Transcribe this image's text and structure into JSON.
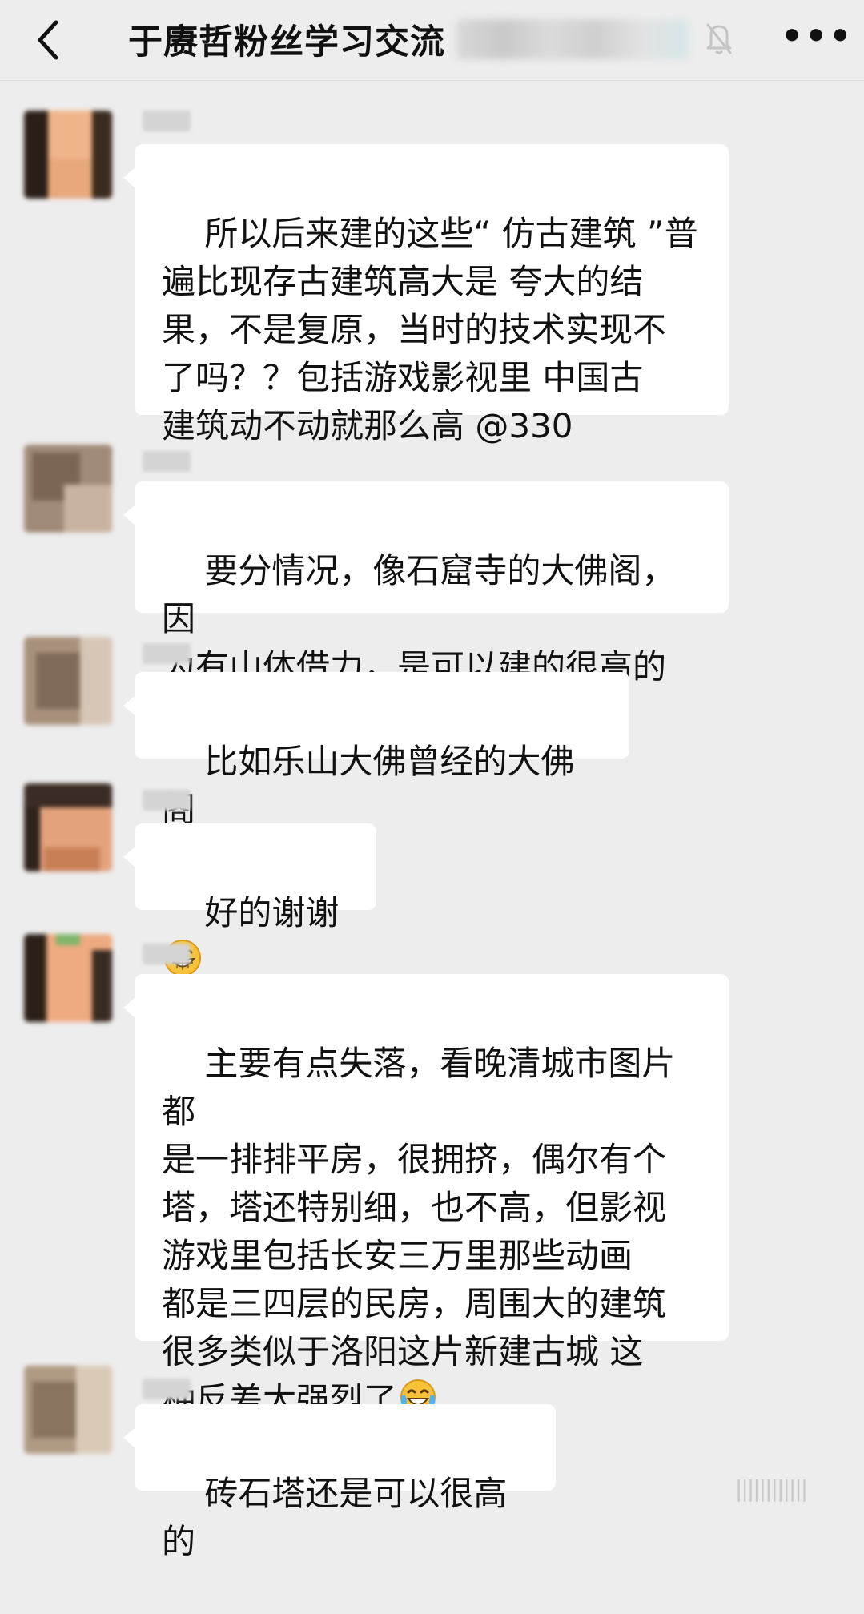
{
  "header": {
    "title": "于赓哲粉丝学习交流",
    "back_icon": "chevron-left-icon",
    "mute_icon": "bell-muted-icon",
    "more_icon": "more-icon",
    "more_label": "•••"
  },
  "messages": [
    {
      "text": "所以后来建的这些“ 仿古建筑 ”普\n遍比现存古建筑高大是 夸大的结\n果，不是复原，当时的技术实现不\n了吗？？包括游戏影视里 中国古\n建筑动不动就那么高 @330"
    },
    {
      "text": "要分情况，像石窟寺的大佛阁，因\n为有山体借力，是可以建的很高的"
    },
    {
      "text": "比如乐山大佛曾经的大佛阁"
    },
    {
      "text": "好的谢谢",
      "emoji": "grin-emoji"
    },
    {
      "text": "主要有点失落，看晚清城市图片都\n是一排排平房，很拥挤，偶尔有个\n塔，塔还特别细，也不高，但影视\n游戏里包括长安三万里那些动画\n都是三四层的民房，周围大的建筑\n很多类似于洛阳这片新建古城 这\n种反差太强烈了",
      "emoji": "tears-of-joy-emoji"
    },
    {
      "text": "砖石塔还是可以很高的"
    }
  ],
  "watermark": "||||||||||||"
}
